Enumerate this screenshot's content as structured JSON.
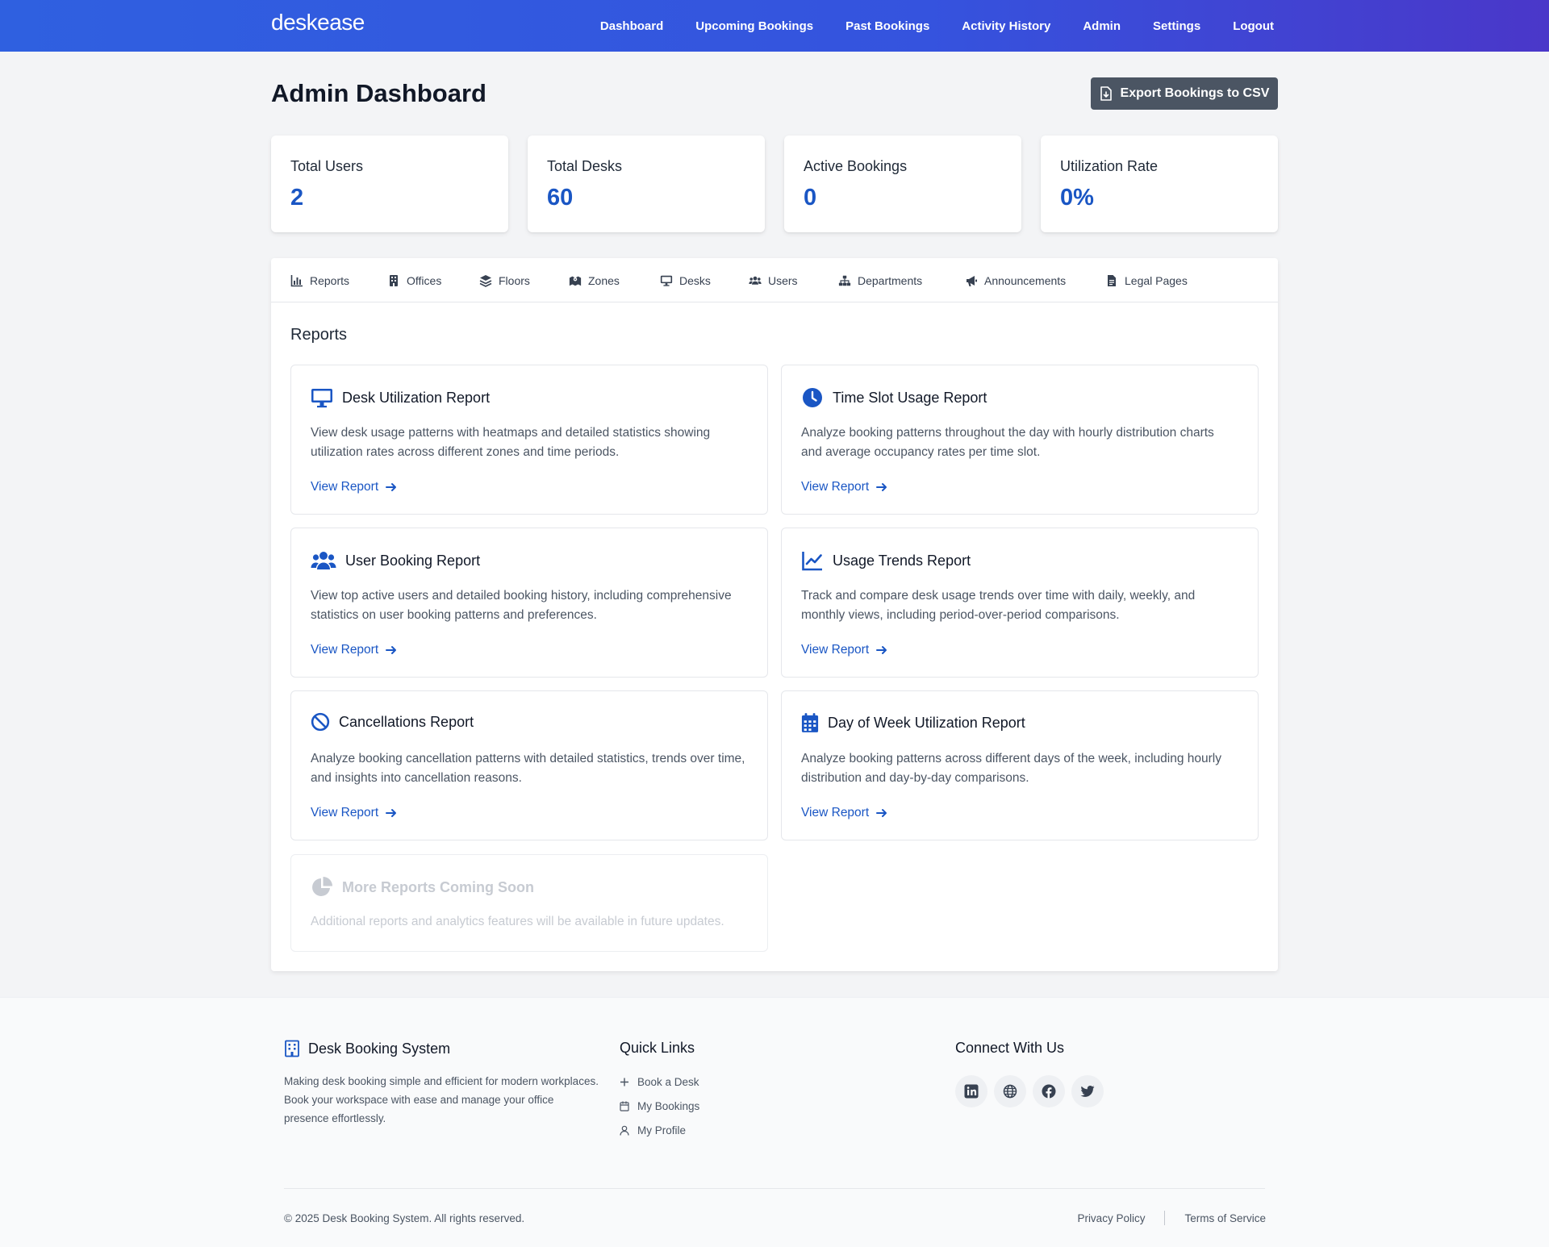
{
  "navbar": {
    "brand": "deskease",
    "links": [
      "Dashboard",
      "Upcoming Bookings",
      "Past Bookings",
      "Activity History",
      "Admin",
      "Settings",
      "Logout"
    ]
  },
  "header": {
    "title": "Admin Dashboard",
    "export_label": "Export Bookings to CSV"
  },
  "stats": [
    {
      "label": "Total Users",
      "value": "2"
    },
    {
      "label": "Total Desks",
      "value": "60"
    },
    {
      "label": "Active Bookings",
      "value": "0"
    },
    {
      "label": "Utilization Rate",
      "value": "0%"
    }
  ],
  "tabs": [
    {
      "label": "Reports",
      "icon": "chart-bar-icon"
    },
    {
      "label": "Offices",
      "icon": "building-icon"
    },
    {
      "label": "Floors",
      "icon": "layers-icon"
    },
    {
      "label": "Zones",
      "icon": "map-icon"
    },
    {
      "label": "Desks",
      "icon": "monitor-icon"
    },
    {
      "label": "Users",
      "icon": "users-icon"
    },
    {
      "label": "Departments",
      "icon": "sitemap-icon"
    },
    {
      "label": "Announcements",
      "icon": "megaphone-icon"
    },
    {
      "label": "Legal Pages",
      "icon": "document-icon"
    }
  ],
  "reports": {
    "section_title": "Reports",
    "link_label": "View Report",
    "cards": [
      {
        "title": "Desk Utilization Report",
        "icon": "monitor-icon",
        "description": "View desk usage patterns with heatmaps and detailed statistics showing utilization rates across different zones and time periods."
      },
      {
        "title": "Time Slot Usage Report",
        "icon": "clock-icon",
        "description": "Analyze booking patterns throughout the day with hourly distribution charts and average occupancy rates per time slot."
      },
      {
        "title": "User Booking Report",
        "icon": "users-icon",
        "description": "View top active users and detailed booking history, including comprehensive statistics on user booking patterns and preferences."
      },
      {
        "title": "Usage Trends Report",
        "icon": "chart-line-icon",
        "description": "Track and compare desk usage trends over time with daily, weekly, and monthly views, including period-over-period comparisons."
      },
      {
        "title": "Cancellations Report",
        "icon": "ban-icon",
        "description": "Analyze booking cancellation patterns with detailed statistics, trends over time, and insights into cancellation reasons."
      },
      {
        "title": "Day of Week Utilization Report",
        "icon": "calendar-icon",
        "description": "Analyze booking patterns across different days of the week, including hourly distribution and day-by-day comparisons."
      }
    ],
    "coming_soon": {
      "title": "More Reports Coming Soon",
      "icon": "chart-pie-icon",
      "description": "Additional reports and analytics features will be available in future updates."
    }
  },
  "footer": {
    "about_title": "Desk Booking System",
    "about_text": "Making desk booking simple and efficient for modern workplaces. Book your workspace with ease and manage your office presence effortlessly.",
    "quick_links_title": "Quick Links",
    "quick_links": [
      {
        "label": "Book a Desk",
        "icon": "plus-icon"
      },
      {
        "label": "My Bookings",
        "icon": "calendar-icon"
      },
      {
        "label": "My Profile",
        "icon": "user-icon"
      }
    ],
    "connect_title": "Connect With Us",
    "socials": [
      "linkedin-icon",
      "globe-icon",
      "facebook-icon",
      "twitter-icon"
    ],
    "copyright": "© 2025 Desk Booking System. All rights reserved.",
    "privacy": "Privacy Policy",
    "terms": "Terms of Service"
  },
  "colors": {
    "accent": "#1a56c4",
    "navbar_start": "#2f60e0",
    "navbar_end": "#4a37c9",
    "export_button": "#4b5563"
  }
}
